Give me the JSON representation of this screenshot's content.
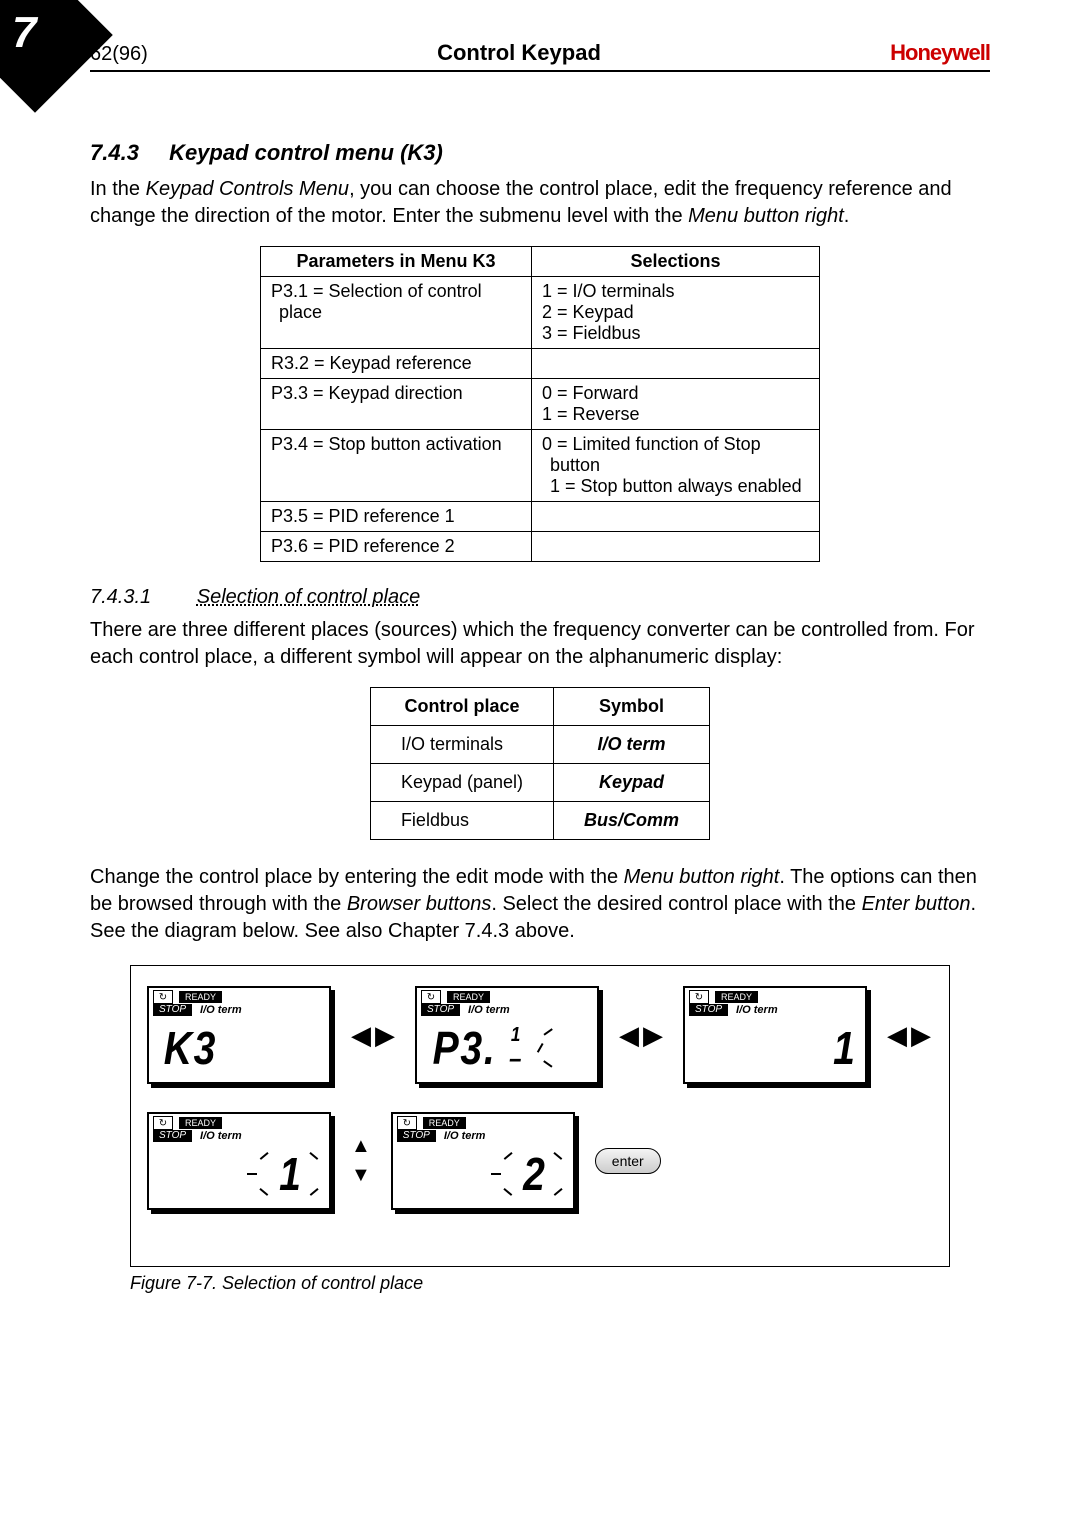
{
  "chapter_number": "7",
  "header": {
    "left": "62(96)",
    "center": "Control Keypad",
    "brand": "Honeywell"
  },
  "sec743": {
    "num": "7.4.3",
    "title": "Keypad control menu (K3)",
    "intro_1": "In the ",
    "intro_em": "Keypad Controls Menu",
    "intro_2": ", you can choose the control place, edit the frequency reference and change the direction of the motor. Enter the submenu level with the ",
    "intro_em2": "Menu button right",
    "intro_3": "."
  },
  "parms_table": {
    "h1": "Parameters in Menu K3",
    "h2": "Selections",
    "rows": [
      {
        "p": "P3.1 = Selection of control place",
        "s": "1 = I/O terminals\n2 = Keypad\n3 = Fieldbus"
      },
      {
        "p": "R3.2 = Keypad reference",
        "s": ""
      },
      {
        "p": "P3.3 = Keypad direction",
        "s": "0 = Forward\n1 = Reverse"
      },
      {
        "p": "P3.4 = Stop button activation",
        "s": "0 = Limited function of Stop button\n1 = Stop button always enabled"
      },
      {
        "p": "P3.5 = PID reference 1",
        "s": ""
      },
      {
        "p": "P3.6 = PID reference 2",
        "s": ""
      }
    ]
  },
  "sec7431": {
    "num": "7.4.3.1",
    "title": "Selection of control place",
    "para": "There are three different places (sources) which the frequency converter can be controlled from. For each control place, a different symbol will appear on the alphanumeric display:"
  },
  "sym_table": {
    "h1": "Control place",
    "h2": "Symbol",
    "rows": [
      {
        "c": "I/O terminals",
        "s": "I/O term"
      },
      {
        "c": "Keypad (panel)",
        "s": "Keypad"
      },
      {
        "c": "Fieldbus",
        "s": "Bus/Comm"
      }
    ]
  },
  "para_change_1": " Change the control place by entering the edit mode with the ",
  "para_change_em1": "Menu button right",
  "para_change_2": ". The options can then be browsed through with the ",
  "para_change_em2": "Browser buttons",
  "para_change_3": ". Select the desired control place with the ",
  "para_change_em3": "Enter button",
  "para_change_4": ". See the diagram below. See also Chapter 7.4.3 above.",
  "diagram": {
    "ready": "READY",
    "stop": "STOP",
    "io": "I/O term",
    "enter": "enter",
    "seg_k3": "K3",
    "seg_p3": "P3.",
    "seg_one_small": "1",
    "seg_dash": "–",
    "seg_one": "1",
    "seg_two": "2"
  },
  "figcaption": "Figure 7-7. Selection of control place"
}
